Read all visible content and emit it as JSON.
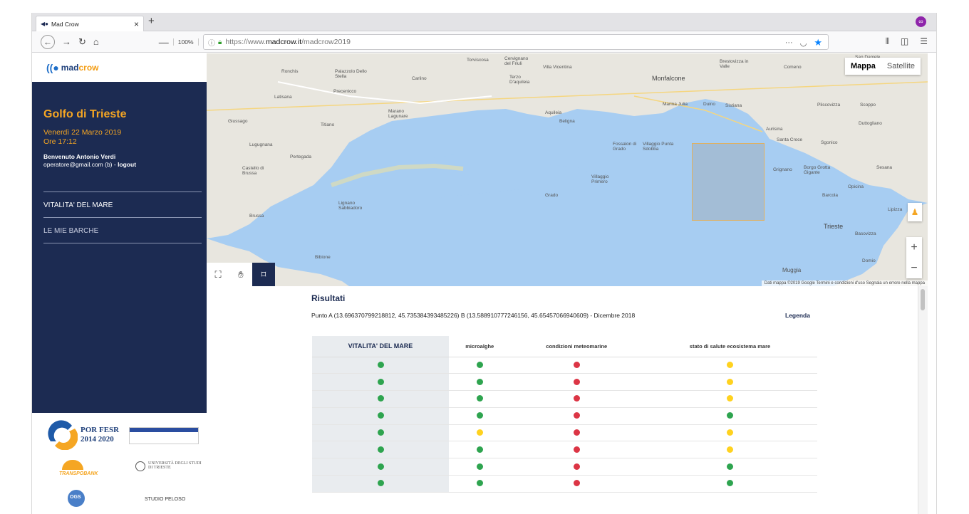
{
  "browser": {
    "tab_title": "Mad Crow",
    "tab_close": "×",
    "new_tab": "+",
    "zoom_minus": "—",
    "zoom_value": "100%",
    "zoom_plus": "+",
    "url_prefix": "https://www.",
    "url_domain": "madcrow.it",
    "url_path": "/madcrow2019",
    "url_more": "···",
    "privacy_badge": "∞"
  },
  "sidebar": {
    "logo_text_1": "mad",
    "logo_text_2": "crow",
    "place": "Golfo di Trieste",
    "date": "Venerdì 22 Marzo 2019",
    "time": "Ore 17:12",
    "welcome": "Benvenuto Antonio Verdi",
    "email": "operatore@gmail.com (b) - ",
    "logout": "logout",
    "menu": [
      {
        "label": "VITALITA' DEL MARE"
      },
      {
        "label": "LE MIE BARCHE"
      }
    ],
    "sponsors": {
      "por": "POR FESR",
      "por_years": "2014 2020",
      "transpobank": "TRANSPOBANK",
      "univ": "UNIVERSITÀ DEGLI STUDI DI TRIESTE",
      "ogs": "OGS",
      "studio": "STUDIO PELOSO"
    }
  },
  "map": {
    "type_map": "Mappa",
    "type_satellite": "Satellite",
    "attribution": "Dati mappa ©2019 Google   Termini e condizioni d'uso   Segnala un errore nella mappa",
    "labels": [
      "Monfalcone",
      "Grado",
      "Lignano Sabbiadoro",
      "Trieste",
      "Muggia",
      "Sistiana",
      "Duino",
      "Aquileia",
      "Latisana",
      "Marano Lagunare",
      "Torviscosa",
      "Cervignano del Friuli",
      "Pertegada",
      "Bibione",
      "Castello di Brussa",
      "Villaggio Primero",
      "Aurisina",
      "Santa Croce",
      "Opicina",
      "Barcola",
      "Sgonico",
      "Basovizza",
      "Lipizza",
      "Villa Vicentina",
      "Terzo D'aquileia",
      "Fossalon di Grado",
      "Villaggio Punta Sdobba",
      "Beligna",
      "Ronchis",
      "Palazzolo Dello Stella",
      "Carlino",
      "Precenicco",
      "Giussago",
      "Titiano",
      "Lugugnana",
      "Brussa",
      "San Daniele",
      "Comeno",
      "Scoppo",
      "Pliscovizza",
      "Duttogliano",
      "Sesana",
      "Grignano",
      "Borgo Grotta Gigante",
      "Domio",
      "Marina Julia",
      "Brestovizza in Valle"
    ]
  },
  "results": {
    "title": "Risultati",
    "description": "Punto A (13.696370799218812, 45.735384393485226) B (13.588910777246156, 45.65457066940609) - Dicembre 2018",
    "legend": "Legenda",
    "columns": [
      "VITALITA' DEL MARE",
      "microalghe",
      "condizioni meteomarine",
      "stato di salute ecosistema mare"
    ],
    "rows": [
      [
        "green",
        "green",
        "red",
        "yellow"
      ],
      [
        "green",
        "green",
        "red",
        "yellow"
      ],
      [
        "green",
        "green",
        "red",
        "yellow"
      ],
      [
        "green",
        "green",
        "red",
        "green"
      ],
      [
        "green",
        "yellow",
        "red",
        "yellow"
      ],
      [
        "green",
        "green",
        "red",
        "yellow"
      ],
      [
        "green",
        "green",
        "red",
        "green"
      ],
      [
        "green",
        "green",
        "red",
        "green"
      ]
    ]
  },
  "colors": {
    "sidebar_bg": "#1c2b52",
    "accent_orange": "#f5a623",
    "status_green": "#2ea44f",
    "status_red": "#dc3545",
    "status_yellow": "#ffd21f"
  }
}
